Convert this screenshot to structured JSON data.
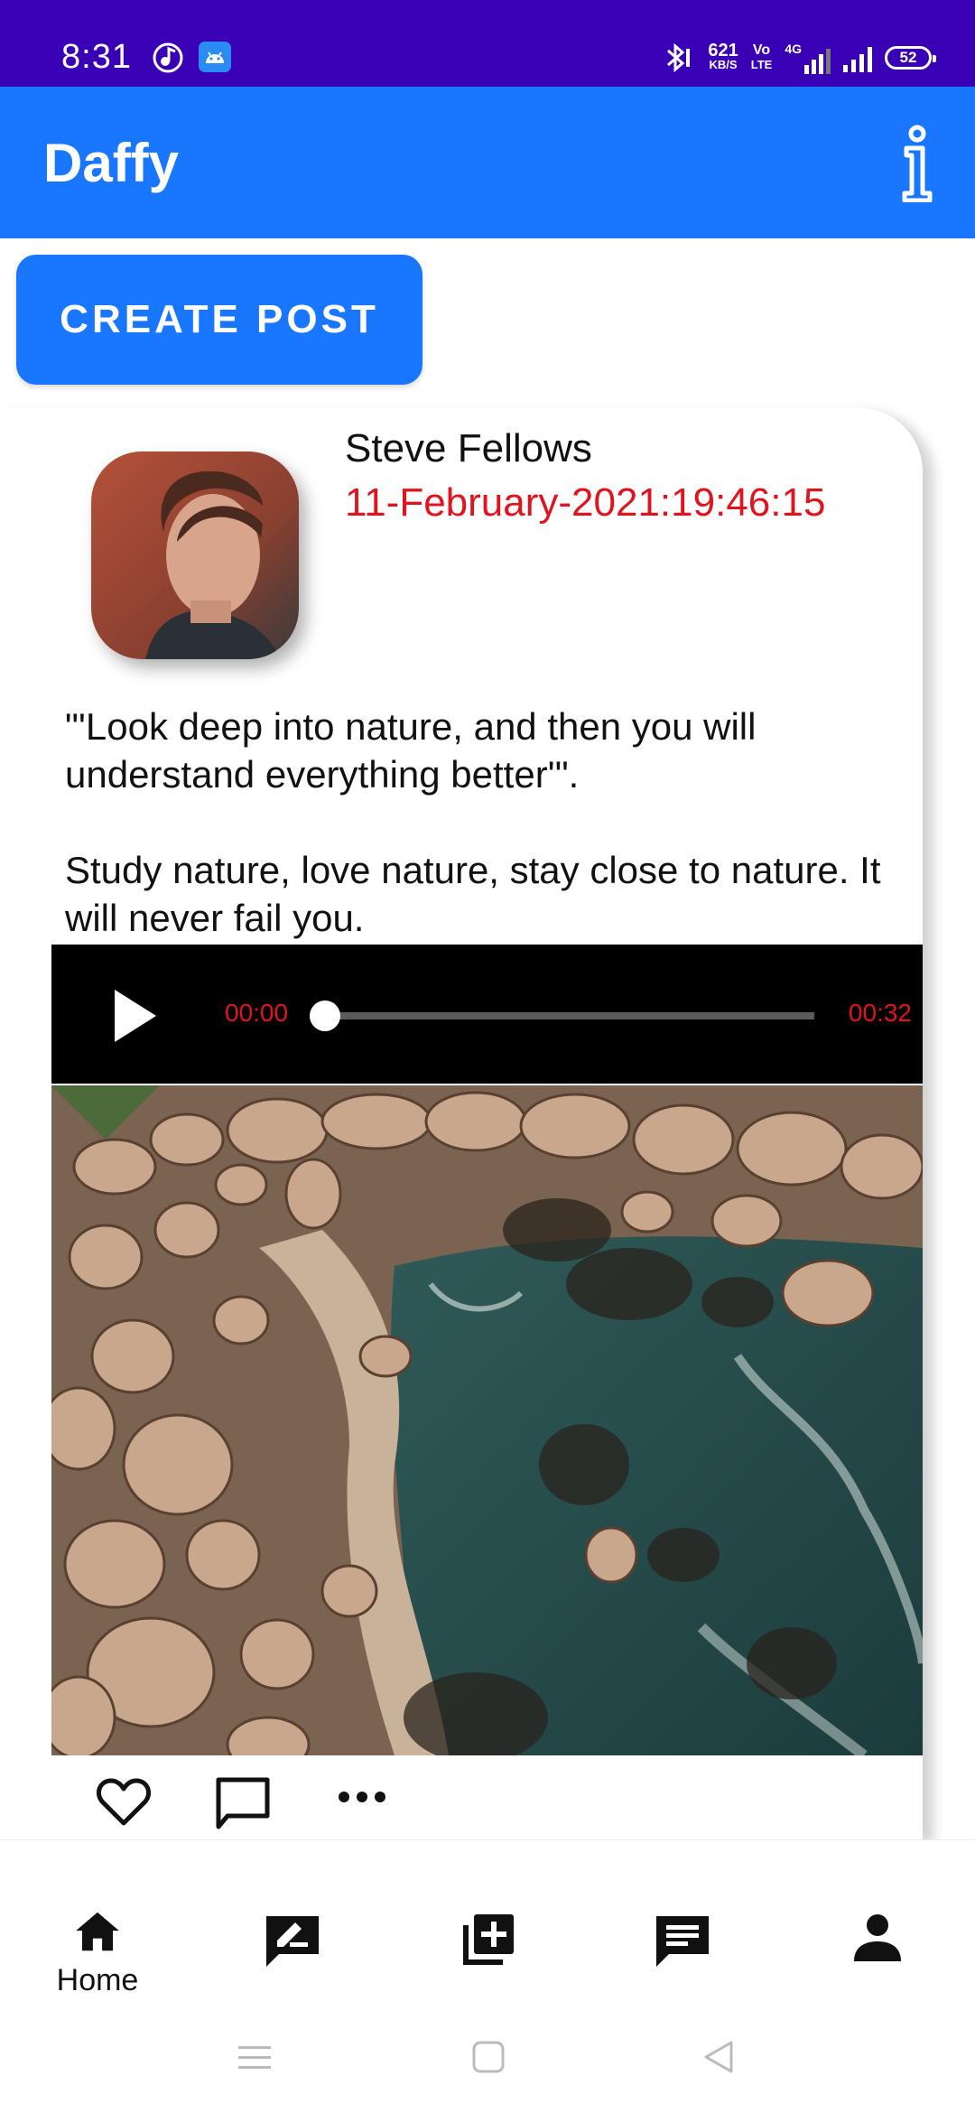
{
  "status_bar": {
    "time": "8:31",
    "net_speed_top": "621",
    "net_speed_bottom": "KB/S",
    "volte_top": "Vo",
    "volte_bottom": "LTE",
    "network": "4G",
    "battery": "52"
  },
  "app_bar": {
    "title": "Daffy",
    "info_icon": "info-icon"
  },
  "create_post": {
    "label": "CREATE POST"
  },
  "post": {
    "author": "Steve Fellows",
    "timestamp": "11-February-2021:19:46:15",
    "text_paragraphs": [
      "\"'Look deep into nature, and then you will understand everything better'\".",
      "Study nature, love nature, stay close to nature. It will never fail you."
    ],
    "audio": {
      "current_time": "00:00",
      "duration": "00:32",
      "progress": 0.0
    },
    "actions": [
      "heart-icon",
      "comment-icon",
      "more-icon"
    ]
  },
  "bottom_nav": {
    "items": [
      {
        "icon": "home-icon",
        "label": "Home",
        "active": true
      },
      {
        "icon": "edit-note-icon",
        "label": ""
      },
      {
        "icon": "add-library-icon",
        "label": ""
      },
      {
        "icon": "chat-icon",
        "label": ""
      },
      {
        "icon": "person-icon",
        "label": ""
      }
    ]
  },
  "colors": {
    "status_bar": "#3a00b5",
    "primary": "#1976ff",
    "timestamp": "#e0141e"
  }
}
